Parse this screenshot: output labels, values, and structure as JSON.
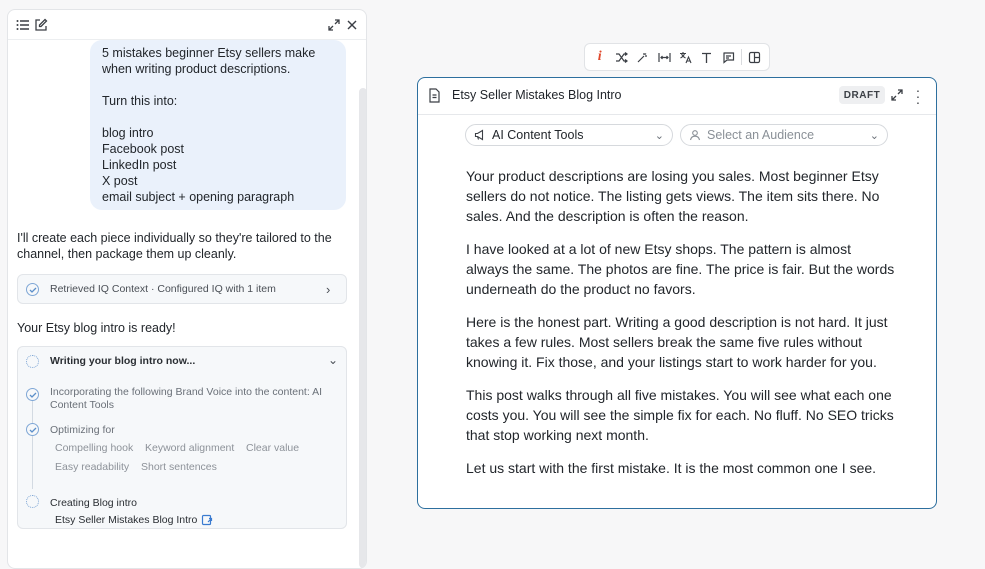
{
  "chat": {
    "user_message": [
      "5 mistakes beginner Etsy sellers make",
      "when writing product descriptions.",
      "",
      "Turn this into:",
      "",
      "blog intro",
      "Facebook post",
      "LinkedIn post",
      "X post",
      "email subject + opening paragraph"
    ],
    "ai_reply_1": [
      "I'll create each piece individually so they're tailored to the",
      "channel, then package them up cleanly."
    ],
    "context_card": "Retrieved IQ Context · Configured IQ with 1 item",
    "ai_reply_2": "Your Etsy blog intro is ready!",
    "progress": {
      "title": "Writing your blog intro now...",
      "step1": [
        "Incorporating the following Brand Voice into the content: AI",
        "Content Tools"
      ],
      "step2": "Optimizing for",
      "tags": [
        "Compelling hook",
        "Keyword alignment",
        "Clear value",
        "Easy readability",
        "Short sentences"
      ],
      "step3": "Creating Blog intro",
      "link": "Etsy Seller Mistakes Blog Intro"
    }
  },
  "toolbar": {
    "icons": [
      "text-color-icon",
      "shuffle-icon",
      "magic-wand-icon",
      "width-icon",
      "translate-icon",
      "text-icon",
      "comment-icon",
      "layout-icon"
    ]
  },
  "document": {
    "title": "Etsy Seller Mistakes Blog Intro",
    "status": "DRAFT",
    "content_tools": "AI Content Tools",
    "audience_placeholder": "Select an Audience",
    "paragraphs": [
      "Your product descriptions are losing you sales. Most beginner Etsy sellers do not notice. The listing gets views. The item sits there. No sales. And the description is often the reason.",
      "I have looked at a lot of new Etsy shops. The pattern is almost always the same. The photos are fine. The price is fair. But the words underneath do the product no favors.",
      "Here is the honest part. Writing a good description is not hard. It just takes a few rules. Most sellers break the same five rules without knowing it. Fix those, and your listings start to work harder for you.",
      "This post walks through all five mistakes. You will see what each one costs you. You will see the simple fix for each. No fluff. No SEO tricks that stop working next month.",
      "Let us start with the first mistake. It is the most common one I see."
    ]
  },
  "colors": {
    "accent": "#2d6f9e",
    "bubble": "#eaf1fb",
    "text_color_icon": "#e0482c"
  }
}
